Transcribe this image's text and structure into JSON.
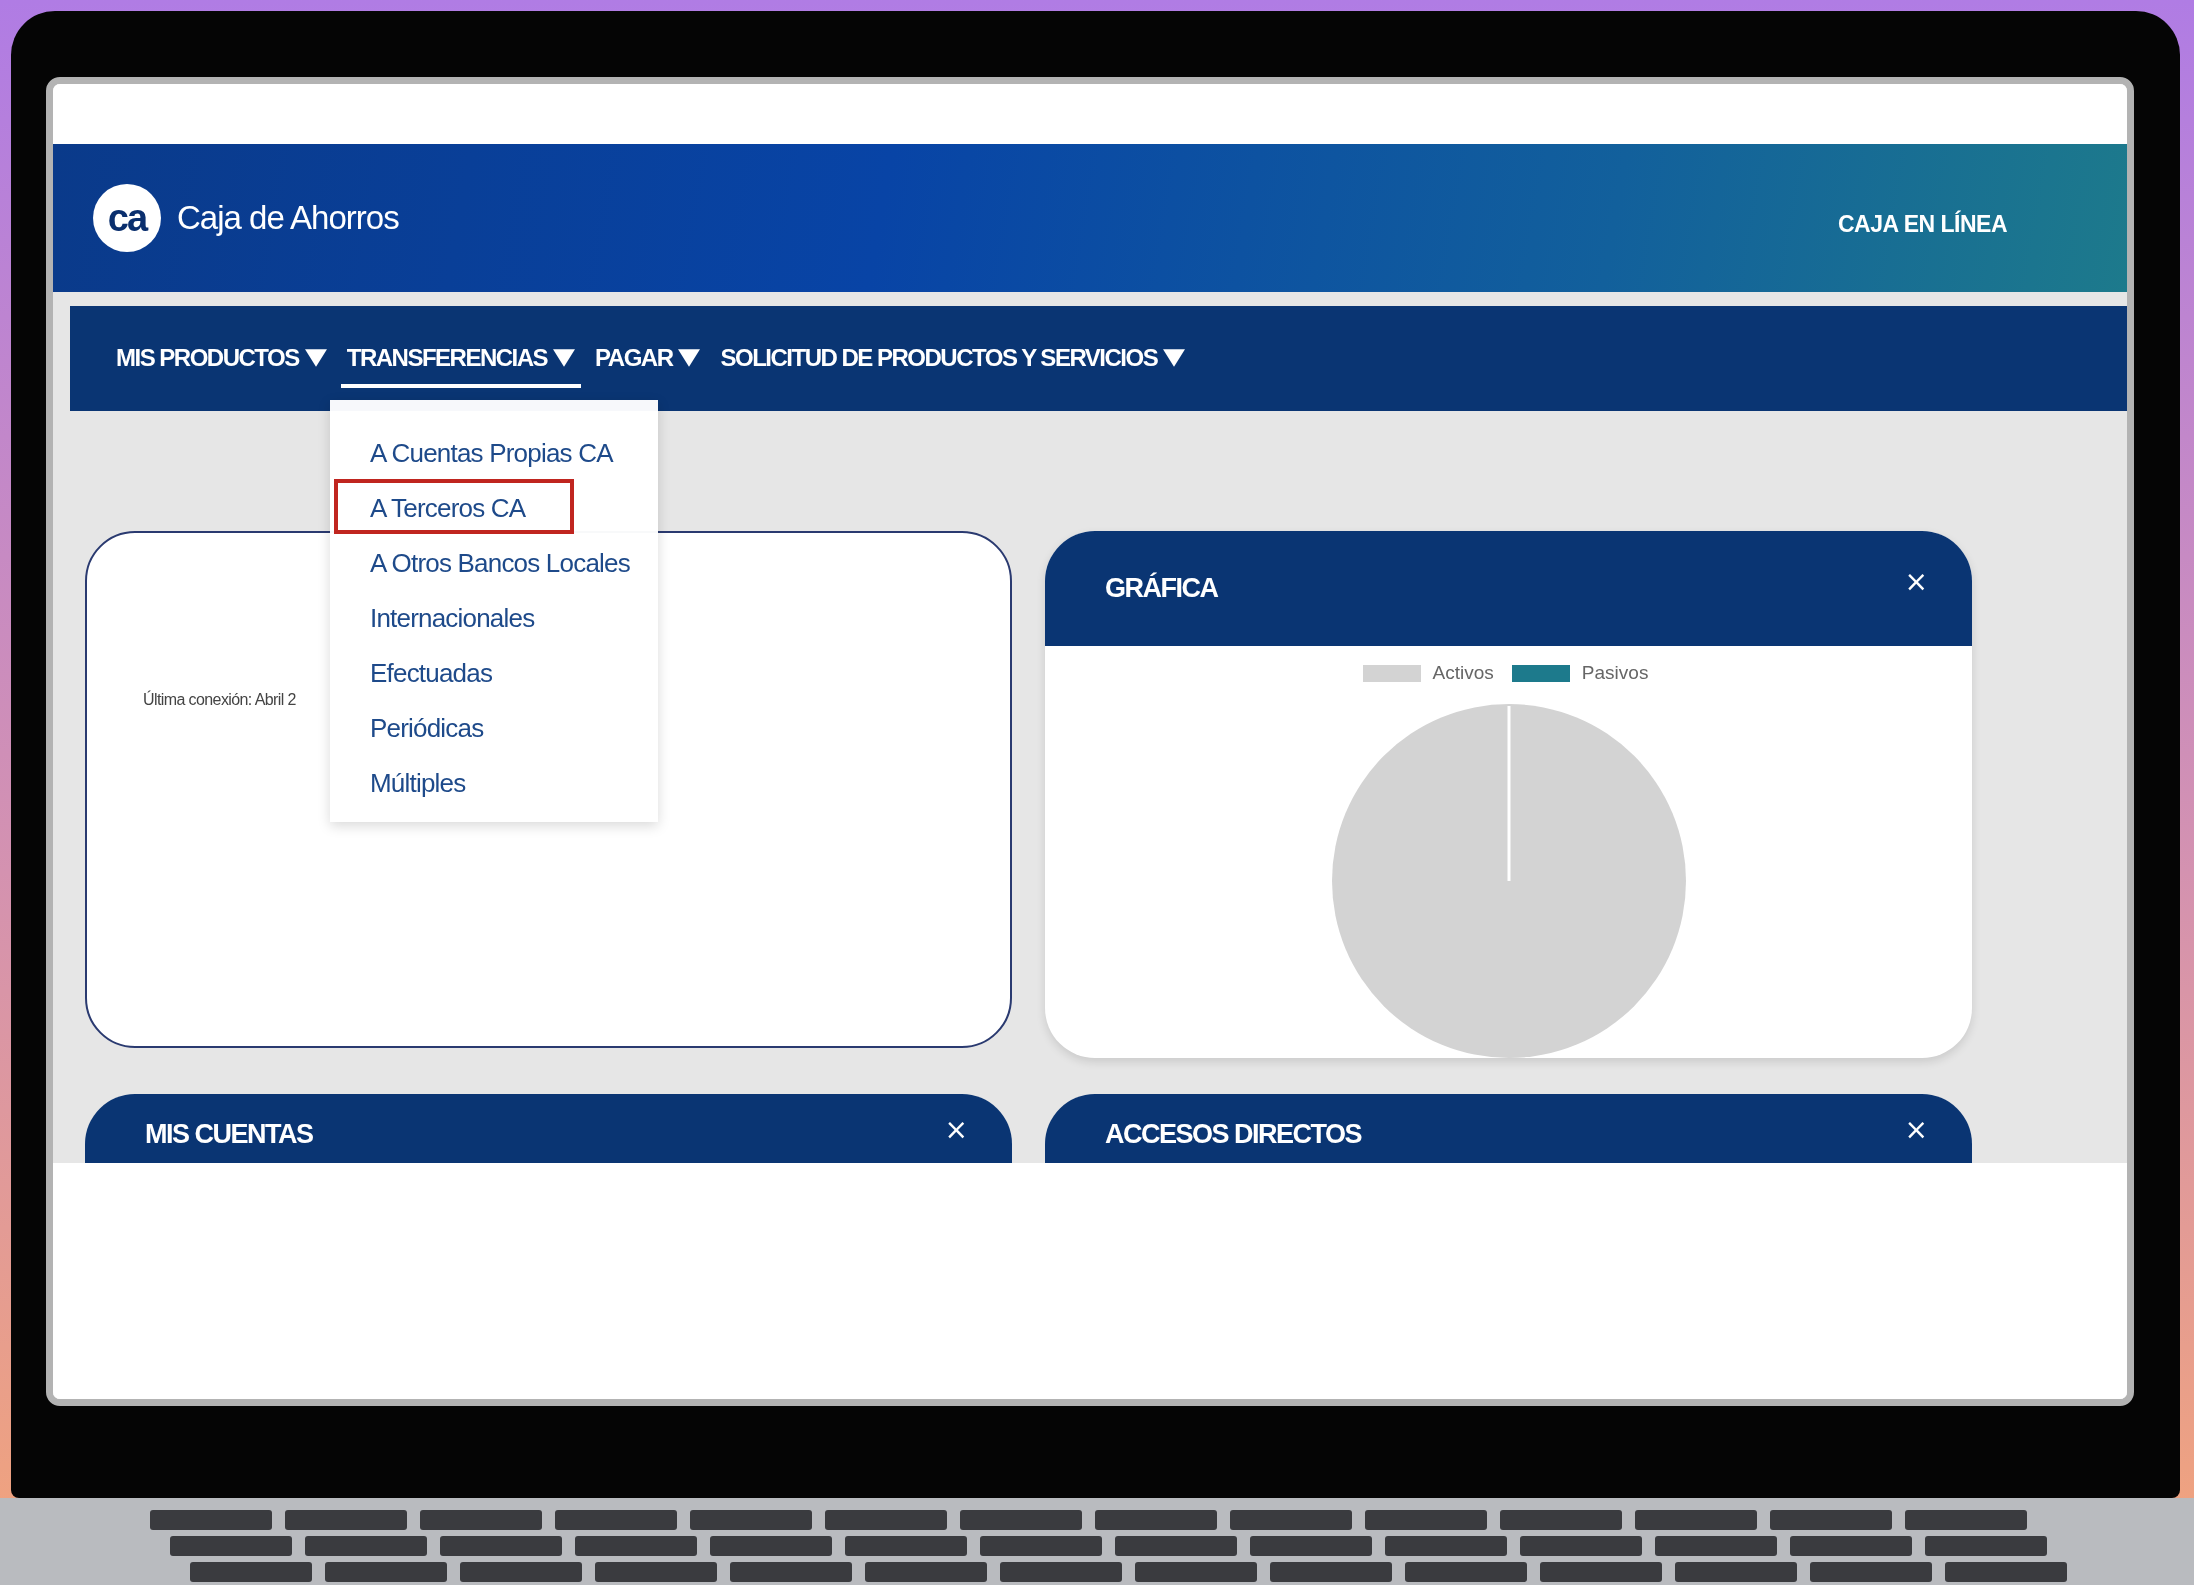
{
  "header": {
    "logo_mark": "ca",
    "brand": "Caja de Ahorros",
    "tagline": "CAJA EN LÍNEA"
  },
  "nav": [
    {
      "label": "MIS PRODUCTOS",
      "selected": false
    },
    {
      "label": "TRANSFERENCIAS",
      "selected": true
    },
    {
      "label": "PAGAR",
      "selected": false
    },
    {
      "label": "SOLICITUD DE PRODUCTOS Y SERVICIOS",
      "selected": false
    }
  ],
  "dropdown": [
    {
      "label": "A Cuentas Propias CA",
      "highlighted": false
    },
    {
      "label": "A Terceros CA",
      "highlighted": true
    },
    {
      "label": "A Otros Bancos Locales",
      "highlighted": false
    },
    {
      "label": "Internacionales",
      "highlighted": false
    },
    {
      "label": "Efectuadas",
      "highlighted": false
    },
    {
      "label": "Periódicas",
      "highlighted": false
    },
    {
      "label": "Múltiples",
      "highlighted": false
    }
  ],
  "profile_card": {
    "last_login": "Última conexión: Abril 2"
  },
  "chart_card": {
    "title": "GRÁFICA",
    "close": "×",
    "legend": [
      {
        "label": "Activos",
        "color": "#d3d3d3"
      },
      {
        "label": "Pasivos",
        "color": "#1d7a8c"
      }
    ]
  },
  "bottom_cards": [
    {
      "title": "MIS CUENTAS",
      "close": "×"
    },
    {
      "title": "ACCESOS DIRECTOS",
      "close": "×"
    }
  ]
}
